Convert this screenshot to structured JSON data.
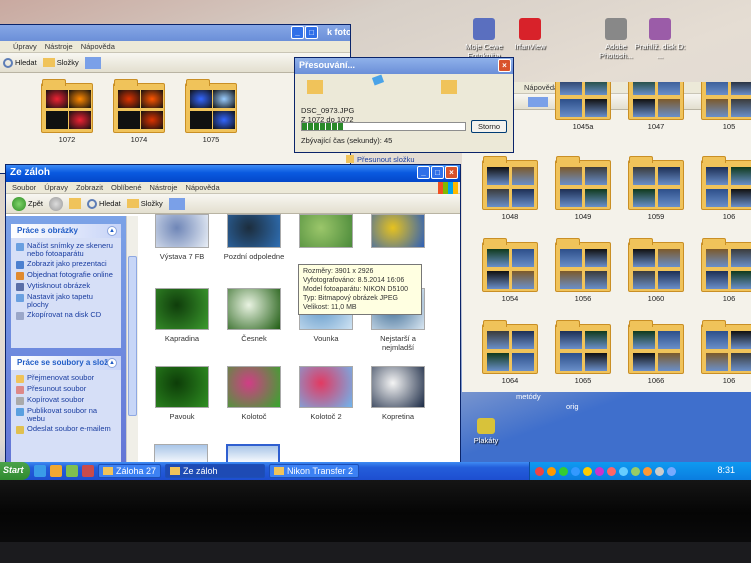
{
  "desktop": {
    "icons": [
      {
        "label": "Moje Cewe Fotokniha",
        "icon": "photobook-icon",
        "color": "#5a6fbf"
      },
      {
        "label": "IrfanView",
        "icon": "irfanview-icon",
        "color": "#d8222a"
      },
      {
        "label": "Adobe Photosh...",
        "icon": "photoshop-icon",
        "color": "#888888"
      },
      {
        "label": "Prahlíž. disk D: ...",
        "icon": "disk-icon",
        "color": "#9b5ca8"
      },
      {
        "label": "Plakáty",
        "icon": "jpg-file-icon",
        "color": "#d8c23a"
      }
    ],
    "right_fragments": [
      "Nápověda",
      "metódy",
      "orig"
    ]
  },
  "back_window": {
    "title_fragment": "k foto",
    "menu": [
      "Úpravy",
      "Nástroje",
      "Nápověda"
    ],
    "toolbar": {
      "search": "Hledat",
      "folders": "Složky"
    },
    "folders": [
      {
        "label": "1072"
      },
      {
        "label": "1074"
      },
      {
        "label": "1075"
      }
    ]
  },
  "right_window": {
    "menu_fragment": "Nápověda",
    "folders": [
      {
        "label": "1045a"
      },
      {
        "label": "1047"
      },
      {
        "label": "105"
      },
      {
        "label": "1048"
      },
      {
        "label": "1049"
      },
      {
        "label": "1059"
      },
      {
        "label": "106"
      },
      {
        "label": "1054"
      },
      {
        "label": "1056"
      },
      {
        "label": "1060"
      },
      {
        "label": "106"
      },
      {
        "label": "1064"
      },
      {
        "label": "1065"
      },
      {
        "label": "1066"
      },
      {
        "label": "106"
      }
    ]
  },
  "move_dialog": {
    "title": "Přesouvání...",
    "filename": "DSC_0973.JPG",
    "from_to": "Z 1072 do 1072",
    "remaining": "Zbývající čas (sekundy): 45",
    "cancel_label": "Storno",
    "progress": 0.25,
    "behind_text": "Přesunout složku"
  },
  "main_window": {
    "title": "Ze záloh",
    "menu": [
      "Soubor",
      "Úpravy",
      "Zobrazit",
      "Oblíbené",
      "Nástroje",
      "Nápověda"
    ],
    "toolbar": {
      "back": "Zpět",
      "search": "Hledat",
      "folders": "Složky"
    },
    "tasks_photos": {
      "title": "Práce s obrázky",
      "items": [
        "Načíst snímky ze skeneru nebo fotoaparátu",
        "Zobrazit jako prezentaci",
        "Objednat fotografie online",
        "Vytisknout obrázek",
        "Nastavit jako tapetu plochy",
        "Zkopírovat na disk CD"
      ]
    },
    "tasks_files": {
      "title": "Práce se soubory a slož",
      "items": [
        "Přejmenovat soubor",
        "Přesunout soubor",
        "Kopírovat soubor",
        "Publikovat soubor na webu",
        "Odeslat soubor e-mailem"
      ]
    },
    "thumbnails": [
      {
        "label": "Výstava 7 FB",
        "colors": [
          "#e8eef6",
          "#6f86b7"
        ]
      },
      {
        "label": "Pozdní odpoledne",
        "colors": [
          "#2f6fb4",
          "#1c2d3d"
        ]
      },
      {
        "label": "",
        "colors": [
          "#4b8a3a",
          "#9bc66a"
        ]
      },
      {
        "label": "",
        "colors": [
          "#2d5fb8",
          "#e6c21f"
        ]
      },
      {
        "label": "Kapradina",
        "colors": [
          "#3c9b2e",
          "#0f3d0b"
        ]
      },
      {
        "label": "Česnek",
        "colors": [
          "#1f5c12",
          "#e9f3e2"
        ]
      },
      {
        "label": "Vounka",
        "colors": [
          "#cfe3f3",
          "#5f97c8"
        ]
      },
      {
        "label": "Nejstarší a nejmladší",
        "colors": [
          "#d8e6f2",
          "#3c6a93"
        ]
      },
      {
        "label": "Pavouk",
        "colors": [
          "#2f8f22",
          "#0d3d08"
        ]
      },
      {
        "label": "Kolotoč",
        "colors": [
          "#35a82b",
          "#d13d86"
        ]
      },
      {
        "label": "Kolotoč 2",
        "colors": [
          "#6fb5ee",
          "#e23a62"
        ]
      },
      {
        "label": "Kopretina",
        "colors": [
          "#1b2a45",
          "#f4f4f4"
        ]
      }
    ],
    "tooltip": [
      "Rozměry: 3901 x 2926",
      "Vyfotografováno: 8.5.2014 16:06",
      "Model fotoaparátu: NIKON D5100",
      "Typ: Bitmapový obrázek JPEG",
      "Velikost: 11,0 MB"
    ]
  },
  "taskbar": {
    "start": "Start",
    "tasks": [
      {
        "label": "Záloha 27"
      },
      {
        "label": "Ze záloh"
      },
      {
        "label": "Nikon Transfer 2"
      }
    ],
    "clock": "8:31",
    "tray_colors": [
      "#e44",
      "#f90",
      "#3c3",
      "#39f",
      "#fc0",
      "#c3c",
      "#f66",
      "#6cf",
      "#9c6",
      "#f93",
      "#ccc",
      "#7af"
    ]
  }
}
